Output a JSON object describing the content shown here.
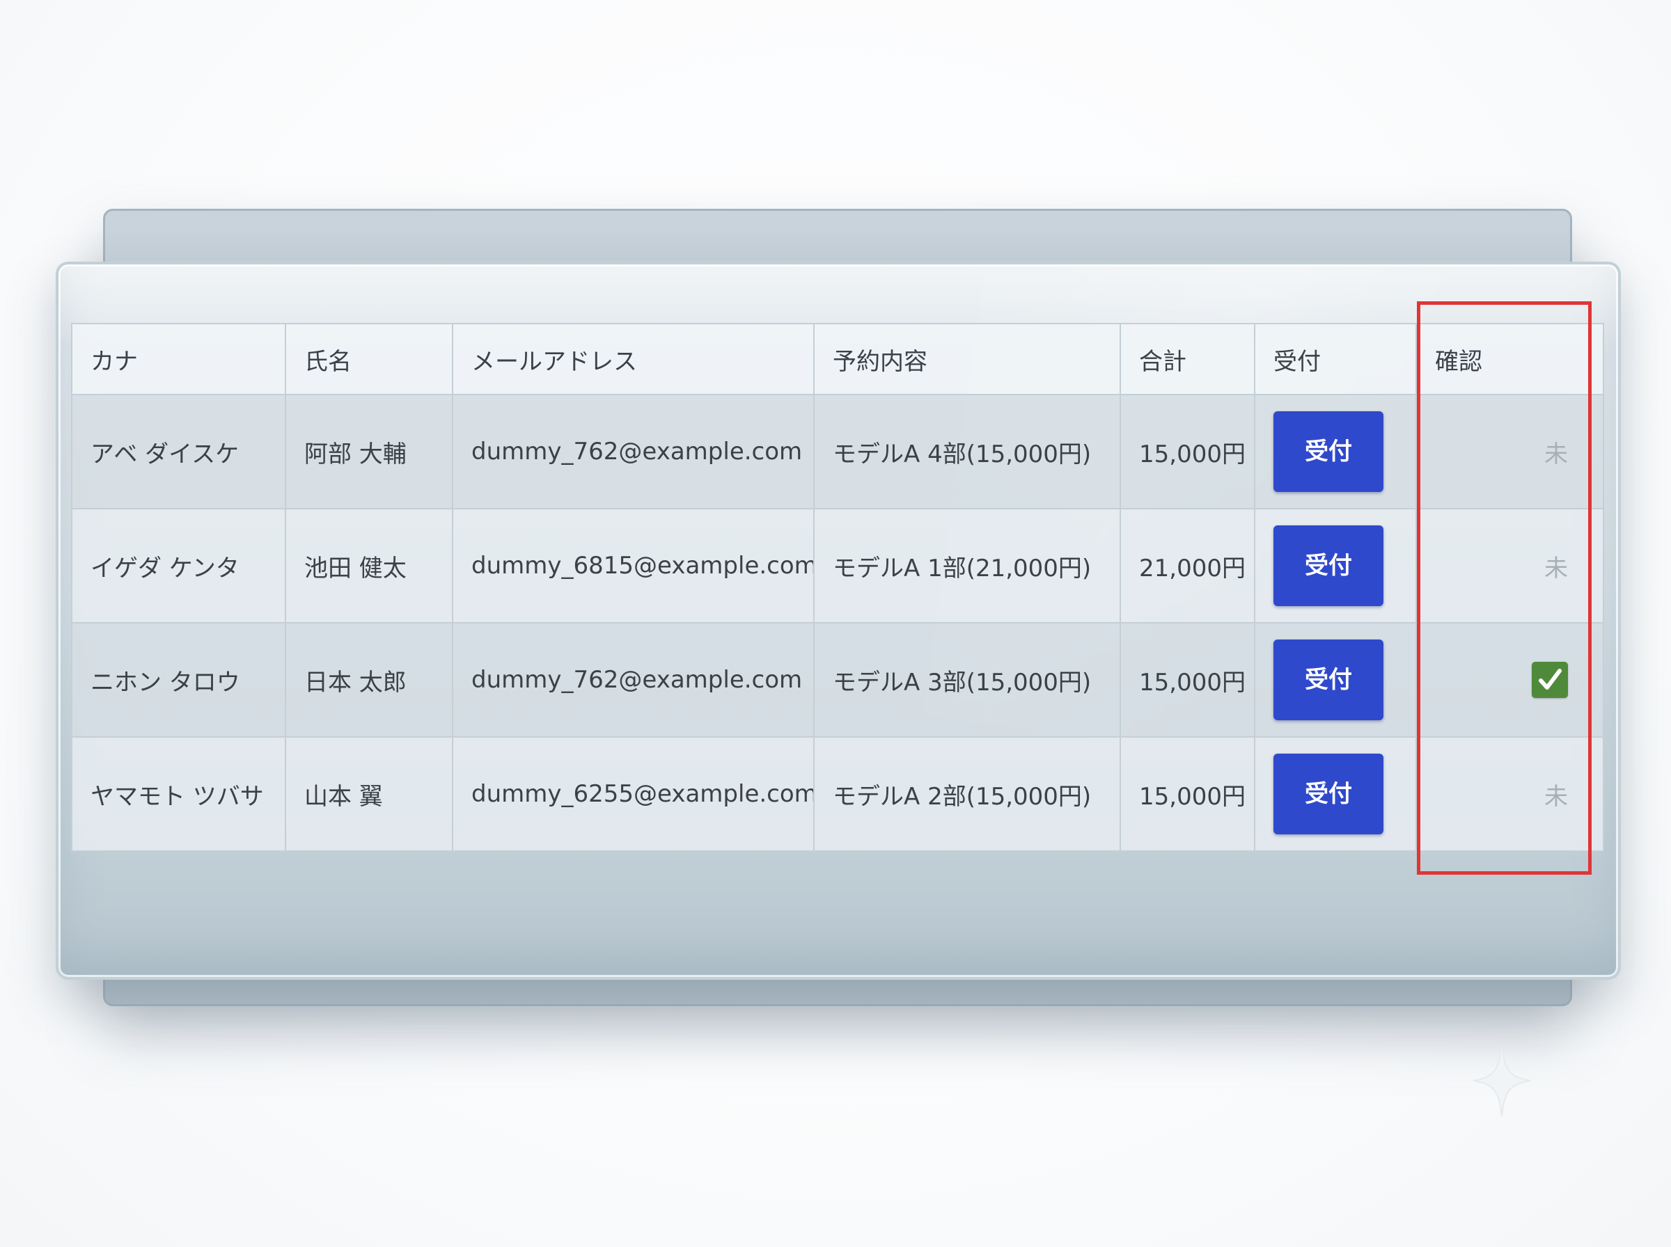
{
  "table": {
    "headers": [
      "カナ",
      "氏名",
      "メールアドレス",
      "予約内容",
      "合計",
      "受付",
      "確認"
    ],
    "rows": [
      {
        "kana": "アベ ダイスケ",
        "name": "阿部 大輔",
        "email": "dummy_762@example.com",
        "reservation": "モデルA 4部(15,000円)",
        "total": "15,000円",
        "button": "受付",
        "status": "未",
        "confirmed": false
      },
      {
        "kana": "イゲダ ケンタ",
        "name": "池田 健太",
        "email": "dummy_6815@example.com",
        "reservation": "モデルA 1部(21,000円)",
        "total": "21,000円",
        "button": "受付",
        "status": "未",
        "confirmed": false
      },
      {
        "kana": "ニホン タロウ",
        "name": "日本 太郎",
        "email": "dummy_762@example.com",
        "reservation": "モデルA 3部(15,000円)",
        "total": "15,000円",
        "button": "受付",
        "status": "",
        "confirmed": true
      },
      {
        "kana": "ヤマモト ツバサ",
        "name": "山本 翼",
        "email": "dummy_6255@example.com",
        "reservation": "モデルA 2部(15,000円)",
        "total": "15,000円",
        "button": "受付",
        "status": "未",
        "confirmed": false
      }
    ]
  },
  "colors": {
    "button": "#2f49cc",
    "check": "#4f8a3b",
    "highlight": "#e03535",
    "pending": "#a7b0b6"
  },
  "icons": {
    "confirmed": "checkmark-icon",
    "sparkle": "sparkle-icon"
  }
}
